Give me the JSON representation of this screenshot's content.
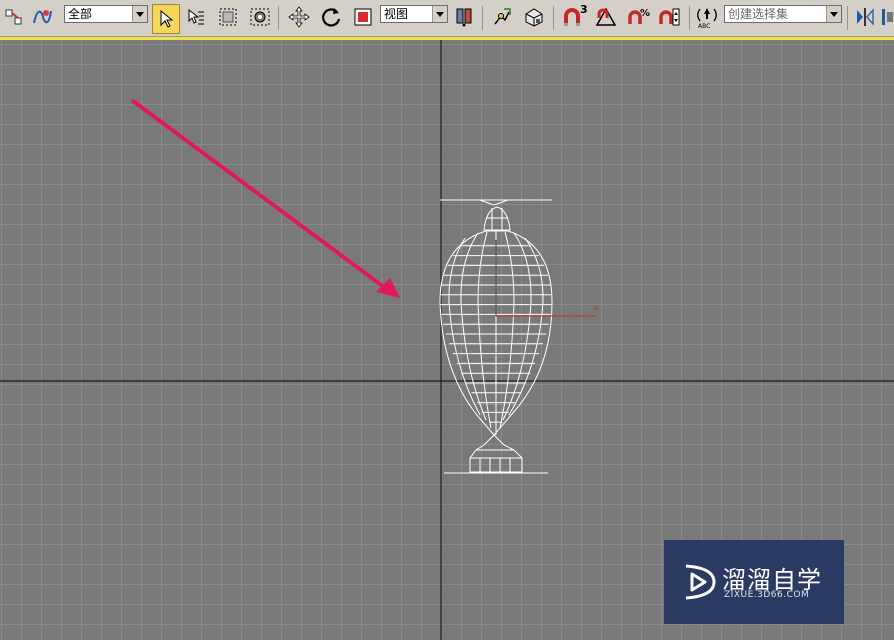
{
  "toolbar": {
    "selection_filter": "全部",
    "reference_coord": "视图",
    "named_selection_placeholder": "创建选择集",
    "icons": [
      "select-and-link-icon",
      "bind-space-warp-icon",
      "select-object-icon",
      "select-by-name-icon",
      "rectangular-selection-icon",
      "window-crossing-icon",
      "select-and-move-icon",
      "select-and-rotate-icon",
      "select-and-scale-icon",
      "use-pivot-center-icon",
      "select-and-manipulate-icon",
      "keyboard-shortcut-override-icon",
      "snaps-toggle-icon",
      "angle-snap-icon",
      "percent-snap-icon",
      "spinner-snap-icon",
      "edit-named-selection-icon",
      "mirror-icon"
    ],
    "snap_label": "3"
  },
  "viewport": {
    "axis_label": "x",
    "colors": {
      "background": "#797979",
      "grid": "#8a8a8a",
      "axis": "#1a1a1a",
      "wireframe": "#ffffff",
      "gizmo_x": "#c83030",
      "annotation_arrow": "#e0195f",
      "active_border": "#f0e445"
    }
  },
  "watermark": {
    "main_text": "溜溜自学",
    "sub_text": "ZIXUE.3D66.COM",
    "icon": "play-logo-icon",
    "background": "#2b3a63"
  }
}
